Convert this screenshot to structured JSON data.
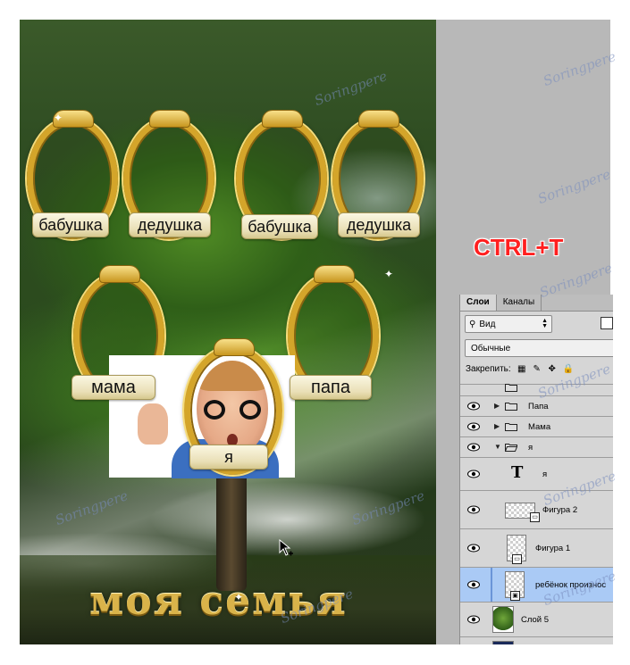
{
  "artwork": {
    "frame_labels": [
      "бабушка",
      "дедушка",
      "бабушка",
      "дедушка"
    ],
    "parent_labels": {
      "mother": "мама",
      "father": "папа"
    },
    "child_label": "я",
    "title": "моя семья"
  },
  "shortcut_hint": "CTRL+T",
  "layers_panel": {
    "tabs": [
      {
        "label": "Слои",
        "active": true
      },
      {
        "label": "Каналы",
        "active": false
      }
    ],
    "filter_label": "Вид",
    "blend_mode": "Обычные",
    "lock_label": "Закрепить:",
    "layers": [
      {
        "name": "",
        "type": "group",
        "visible": false,
        "partial": true
      },
      {
        "name": "Папа",
        "type": "group",
        "visible": true,
        "expanded": false
      },
      {
        "name": "Мама",
        "type": "group",
        "visible": true,
        "expanded": false
      },
      {
        "name": "я",
        "type": "group",
        "visible": true,
        "expanded": true
      },
      {
        "name": "я",
        "type": "text",
        "visible": true
      },
      {
        "name": "Фигура 2",
        "type": "shape",
        "visible": true
      },
      {
        "name": "Фигура 1",
        "type": "shape",
        "visible": true
      },
      {
        "name": "ребёнок произнос",
        "type": "smart-object",
        "visible": true,
        "selected": true
      },
      {
        "name": "Слой 5",
        "type": "pixel",
        "visible": true
      },
      {
        "name": "",
        "type": "pixel",
        "visible": false,
        "partial": true
      }
    ]
  },
  "watermark": "Soringpere"
}
